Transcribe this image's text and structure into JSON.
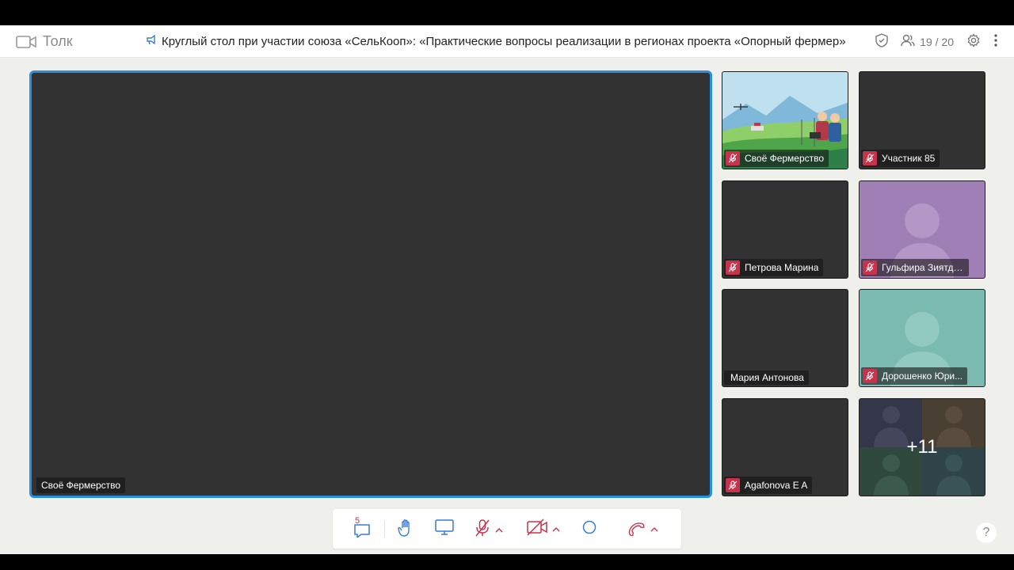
{
  "app": {
    "name": "Толк"
  },
  "meeting": {
    "title": "Круглый стол при участии союза «СельКооп»: «Практические вопросы реализации в регионах проекта «Опорный фермер»"
  },
  "header": {
    "participants": "19 / 20"
  },
  "main_video": {
    "name": "Своё Фермерство"
  },
  "tiles": [
    {
      "name": "Своё Фермерство",
      "muted": true
    },
    {
      "name": "Участник 85",
      "muted": true
    },
    {
      "name": "Петрова Марина",
      "muted": true
    },
    {
      "name": "Гульфира Зиятди...",
      "muted": true,
      "avatar_bg": "#a07fb6"
    },
    {
      "name": "Мария Антонова",
      "muted": false
    },
    {
      "name": "Дорошенко Юри...",
      "muted": true,
      "avatar_bg": "#7bbab0"
    },
    {
      "name": "Agafonova E A",
      "muted": true
    },
    {
      "more": "+11"
    }
  ],
  "toolbar": {
    "chat_unread": "5"
  },
  "help": {
    "label": "?"
  },
  "colors": {
    "accent": "#2b8fe0",
    "danger": "#c6334a",
    "tile_bg": "#323232"
  },
  "icons": [
    "camera-icon",
    "megaphone-icon",
    "shield-icon",
    "users-icon",
    "gear-icon",
    "more-vertical-icon",
    "chat-icon",
    "hand-icon",
    "screen-share-icon",
    "mic-off-icon",
    "chevron-up-icon",
    "camera-off-icon",
    "record-icon",
    "phone-hangup-icon",
    "help-icon"
  ]
}
